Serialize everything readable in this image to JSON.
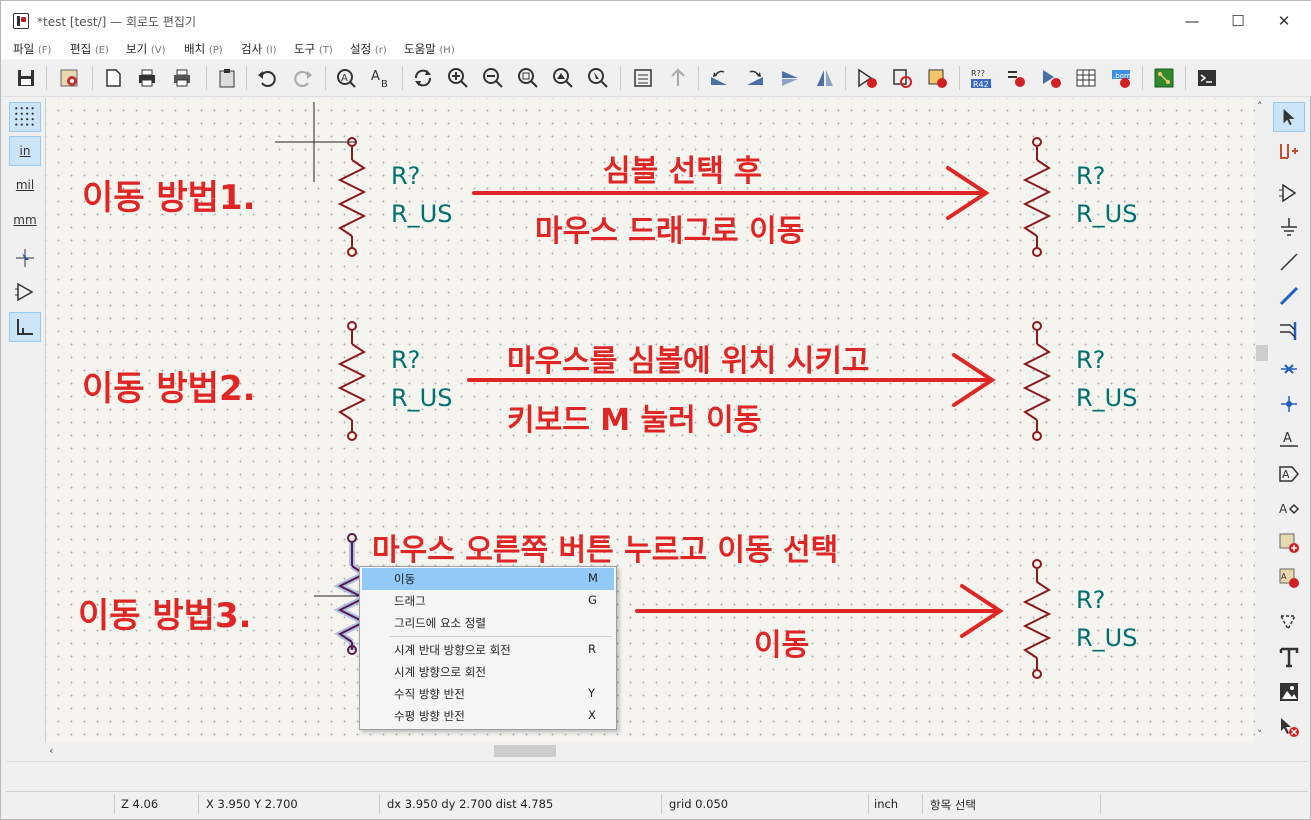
{
  "window": {
    "title": "*test [test/] — 회로도 편집기",
    "min": "—",
    "max": "☐",
    "close": "✕"
  },
  "menu": [
    {
      "label": "파일",
      "mn": "(F)"
    },
    {
      "label": "편집",
      "mn": "(E)"
    },
    {
      "label": "보기",
      "mn": "(V)"
    },
    {
      "label": "배치",
      "mn": "(P)"
    },
    {
      "label": "검사",
      "mn": "(I)"
    },
    {
      "label": "도구",
      "mn": "(T)"
    },
    {
      "label": "설정",
      "mn": "(r)"
    },
    {
      "label": "도움말",
      "mn": "(H)"
    }
  ],
  "left_toolbar": {
    "in": "in",
    "mil": "mil",
    "mm": "mm"
  },
  "canvas": {
    "method1": "이동 방법1.",
    "method2": "이동 방법2.",
    "method3": "이동 방법3.",
    "desc1_line1": "심볼 선택 후",
    "desc1_line2": "마우스 드래그로 이동",
    "desc2_line1": "마우스를 심볼에 위치 시키고",
    "desc2_line2": "키보드 M 눌러 이동",
    "desc3_line1": "마우스 오른쪽 버튼 누르고 이동 선택",
    "desc3_line2": "이동",
    "ref": "R?",
    "value": "R_US",
    "text_color": "#e02525",
    "symbol_color": "#8b1a1a",
    "label_color": "#007070"
  },
  "context_menu": {
    "items": [
      {
        "label": "이동",
        "key": "M"
      },
      {
        "label": "드래그",
        "key": "G"
      },
      {
        "label": "그리드에 요소 정렬",
        "key": ""
      },
      {
        "label": "시계 반대 방향으로 회전",
        "key": "R"
      },
      {
        "label": "시계 방향으로 회전",
        "key": ""
      },
      {
        "label": "수직 방향 반전",
        "key": "Y"
      },
      {
        "label": "수평 방향 반전",
        "key": "X"
      }
    ]
  },
  "status": {
    "zoom": "Z 4.06",
    "xy": "X 3.950  Y 2.700",
    "delta": "dx 3.950  dy 2.700  dist 4.785",
    "grid": "grid 0.050",
    "units": "inch",
    "mode": "항목 선택"
  }
}
